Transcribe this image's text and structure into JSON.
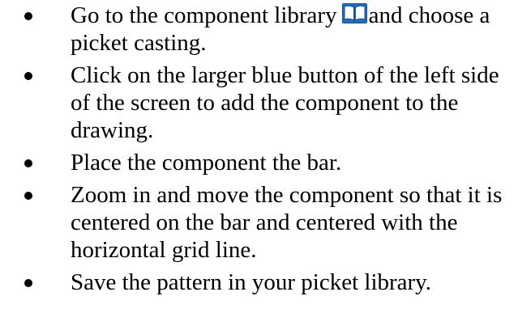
{
  "bullets": [
    {
      "before_icon": "Go to the component library",
      "icon": "book-icon",
      "after_icon": "and choose a picket casting."
    },
    {
      "text": "Click on the larger blue button of the left side of the screen to add the component to the drawing."
    },
    {
      "text": "Place the component the bar."
    },
    {
      "text": "Zoom in and move the component so that it is centered on the bar and centered with the horizontal grid line."
    },
    {
      "text": "Save the pattern in your picket library."
    }
  ],
  "colors": {
    "text": "#000000",
    "icon_frame": "#1f6fc2",
    "icon_pages": "#ffffff"
  }
}
